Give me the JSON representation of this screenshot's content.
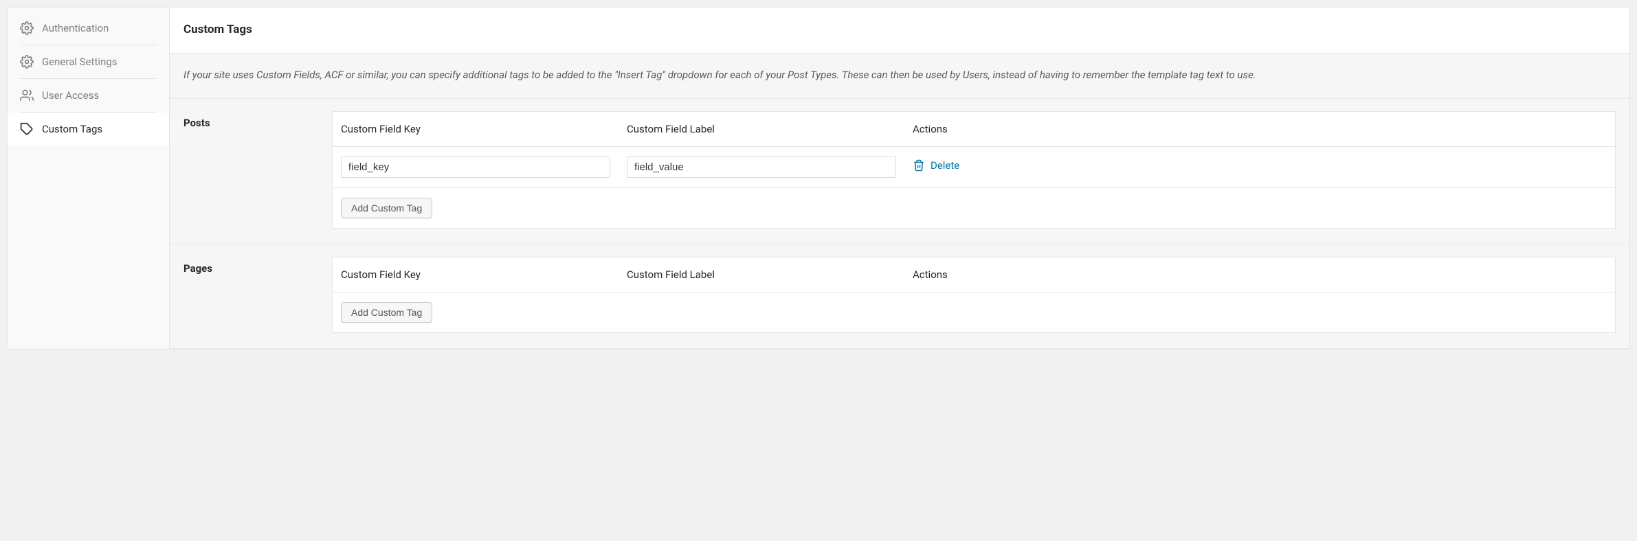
{
  "sidebar": {
    "items": [
      {
        "label": "Authentication"
      },
      {
        "label": "General Settings"
      },
      {
        "label": "User Access"
      },
      {
        "label": "Custom Tags"
      }
    ]
  },
  "header": {
    "title": "Custom Tags"
  },
  "description": "If your site uses Custom Fields, ACF or similar, you can specify additional tags to be added to the \"Insert Tag\" dropdown for each of your Post Types. These can then be used by Users, instead of having to remember the template tag text to use.",
  "columns": {
    "key": "Custom Field Key",
    "label": "Custom Field Label",
    "actions": "Actions"
  },
  "sections": {
    "posts": {
      "title": "Posts",
      "rows": [
        {
          "key": "field_key",
          "label": "field_value"
        }
      ],
      "addButton": "Add Custom Tag"
    },
    "pages": {
      "title": "Pages",
      "addButton": "Add Custom Tag"
    }
  },
  "actions": {
    "delete": "Delete"
  }
}
